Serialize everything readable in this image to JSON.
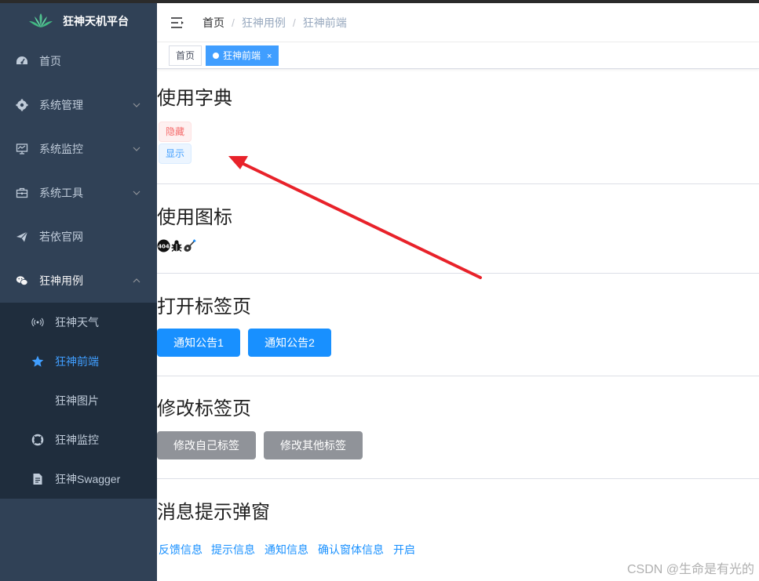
{
  "app": {
    "title": "狂神天机平台"
  },
  "sidebar": {
    "items": [
      {
        "label": "首页",
        "icon": "dashboard-icon"
      },
      {
        "label": "系统管理",
        "icon": "gear-icon"
      },
      {
        "label": "系统监控",
        "icon": "monitor-icon"
      },
      {
        "label": "系统工具",
        "icon": "toolbox-icon"
      },
      {
        "label": "若依官网",
        "icon": "send-icon"
      },
      {
        "label": "狂神用例",
        "icon": "wechat-icon"
      }
    ],
    "subitems": [
      {
        "label": "狂神天气",
        "icon": "broadcast-icon"
      },
      {
        "label": "狂神前端",
        "icon": "star-icon"
      },
      {
        "label": "狂神图片",
        "icon": ""
      },
      {
        "label": "狂神监控",
        "icon": "lifebuoy-icon"
      },
      {
        "label": "狂神Swagger",
        "icon": "document-icon"
      }
    ]
  },
  "breadcrumb": {
    "home": "首页",
    "level1": "狂神用例",
    "level2": "狂神前端",
    "sep": "/"
  },
  "tags": {
    "home": "首页",
    "active": "狂神前端",
    "close": "×"
  },
  "sections": {
    "dict": {
      "title": "使用字典",
      "tag_hidden": "隐藏",
      "tag_show": "显示"
    },
    "icons": {
      "title": "使用图标"
    },
    "open_tab": {
      "title": "打开标签页",
      "btn1": "通知公告1",
      "btn2": "通知公告2"
    },
    "modify_tab": {
      "title": "修改标签页",
      "btn1": "修改自己标签",
      "btn2": "修改其他标签"
    },
    "message": {
      "title": "消息提示弹窗",
      "links": [
        "反馈信息",
        "提示信息",
        "通知信息",
        "确认窗体信息",
        "开启"
      ]
    }
  },
  "watermark": "CSDN @生命是有光的",
  "colors": {
    "sidebar": "#304156",
    "submenu": "#1f2d3d",
    "accent": "#409eff",
    "primary": "#1890ff",
    "info": "#909399",
    "arrow": "#e8222a"
  }
}
